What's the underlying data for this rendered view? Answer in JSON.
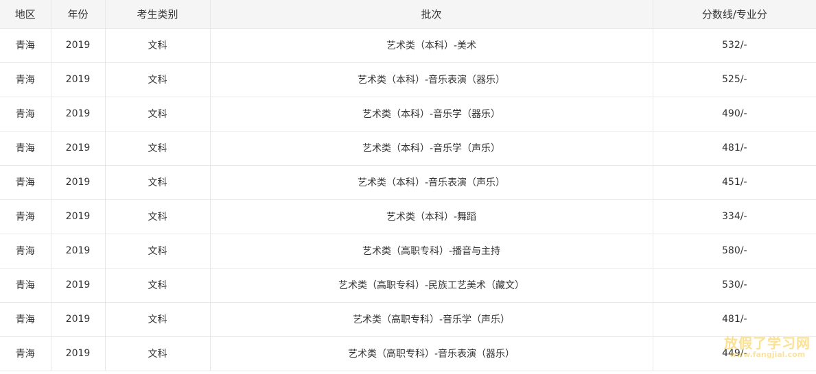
{
  "table": {
    "headers": [
      "地区",
      "年份",
      "考生类别",
      "批次",
      "分数线/专业分"
    ],
    "rows": [
      [
        "青海",
        "2019",
        "文科",
        "艺术类（本科）-美术",
        "532/-"
      ],
      [
        "青海",
        "2019",
        "文科",
        "艺术类（本科）-音乐表演（器乐）",
        "525/-"
      ],
      [
        "青海",
        "2019",
        "文科",
        "艺术类（本科）-音乐学（器乐）",
        "490/-"
      ],
      [
        "青海",
        "2019",
        "文科",
        "艺术类（本科）-音乐学（声乐）",
        "481/-"
      ],
      [
        "青海",
        "2019",
        "文科",
        "艺术类（本科）-音乐表演（声乐）",
        "451/-"
      ],
      [
        "青海",
        "2019",
        "文科",
        "艺术类（本科）-舞蹈",
        "334/-"
      ],
      [
        "青海",
        "2019",
        "文科",
        "艺术类（高职专科）-播音与主持",
        "580/-"
      ],
      [
        "青海",
        "2019",
        "文科",
        "艺术类（高职专科）-民族工艺美术（藏文）",
        "530/-"
      ],
      [
        "青海",
        "2019",
        "文科",
        "艺术类（高职专科）-音乐学（声乐）",
        "481/-"
      ],
      [
        "青海",
        "2019",
        "文科",
        "艺术类（高职专科）-音乐表演（器乐）",
        "449/-"
      ]
    ]
  },
  "watermark": {
    "main": "放假了学习网",
    "sub": "www.fangjial.com"
  }
}
